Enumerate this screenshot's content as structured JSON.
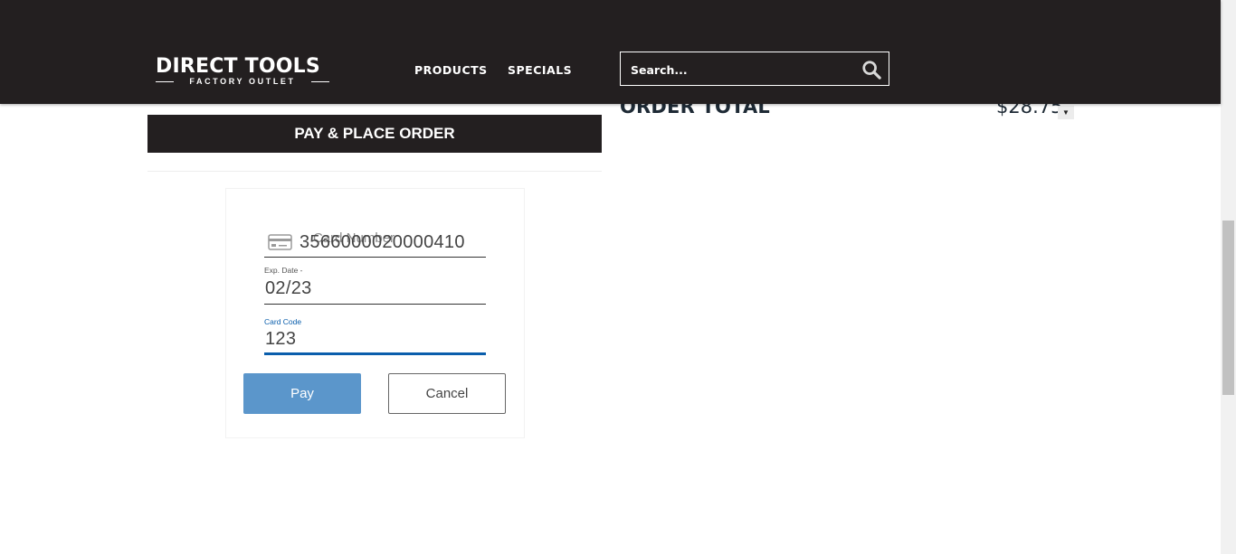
{
  "header": {
    "logo": {
      "main": "DIRECT TOOLS",
      "sub": "FACTORY OUTLET"
    },
    "nav": [
      {
        "label": "PRODUCTS"
      },
      {
        "label": "SPECIALS"
      }
    ],
    "search": {
      "placeholder": "Search...",
      "icon": "search-icon"
    }
  },
  "summary": {
    "order_total_label": "ORDER TOTAL",
    "order_total_value": "$28.75",
    "dropdown_icon": "chevron-down-icon"
  },
  "checkout": {
    "place_order_label": "PAY & PLACE ORDER"
  },
  "payment_form": {
    "card_number": {
      "placeholder": "Card Number",
      "value": "3566000020000410",
      "icon": "credit-card-icon"
    },
    "exp_date": {
      "label": "Exp. Date -",
      "value": "02/23"
    },
    "card_code": {
      "label": "Card Code",
      "value": "123"
    },
    "pay_label": "Pay",
    "cancel_label": "Cancel"
  },
  "colors": {
    "header_bg": "#231f20",
    "pay_button": "#5b96cb",
    "active_field": "#0a5eac"
  }
}
